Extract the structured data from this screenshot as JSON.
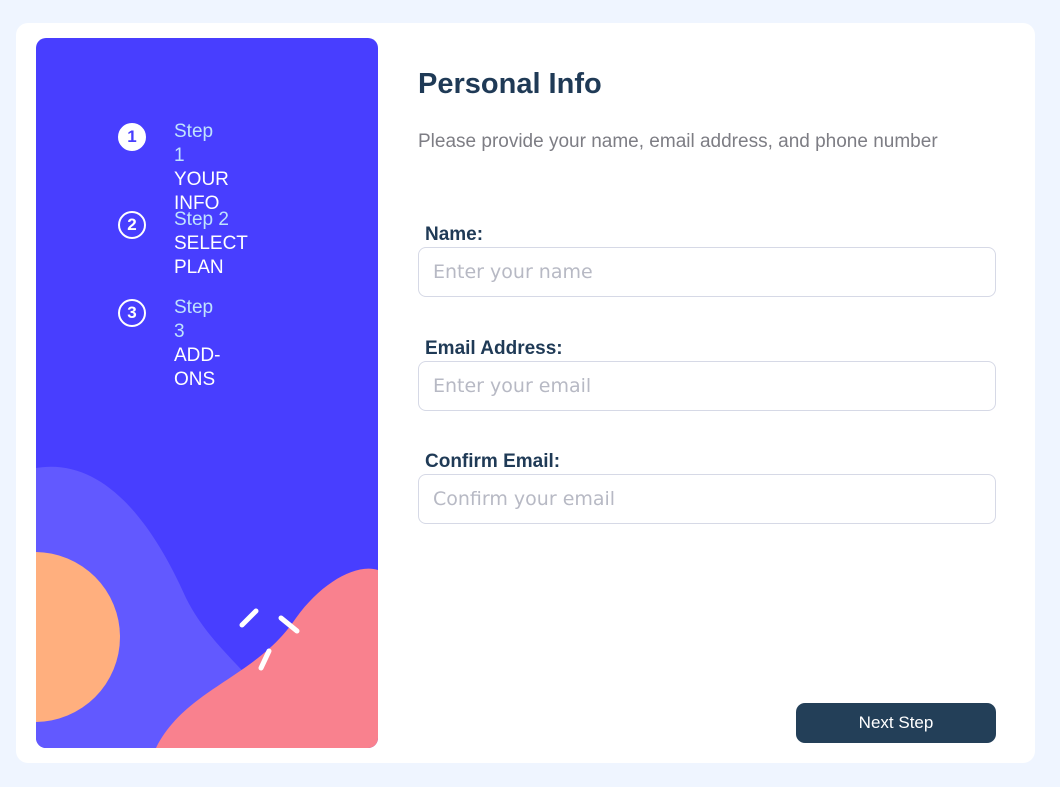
{
  "sidebar": {
    "steps": [
      {
        "number": "1",
        "step_label": "Step 1",
        "title": "YOUR INFO",
        "active": true
      },
      {
        "number": "2",
        "step_label": "Step 2",
        "title": "SELECT PLAN",
        "active": false
      },
      {
        "number": "3",
        "step_label": "Step 3",
        "title": "ADD-ONS",
        "active": false
      }
    ]
  },
  "main": {
    "title": "Personal Info",
    "subtitle": "Please provide your name, email address, and phone number",
    "fields": [
      {
        "label": "Name:",
        "placeholder": "Enter your name",
        "value": ""
      },
      {
        "label": "Email Address:",
        "placeholder": "Enter your email",
        "value": ""
      },
      {
        "label": "Confirm Email:",
        "placeholder": "Confirm your email",
        "value": ""
      }
    ],
    "next_button": "Next Step"
  },
  "colors": {
    "sidebar_bg": "#483eff",
    "primary_text": "#1f3a56",
    "button_bg": "#233f58",
    "shape_purple": "#6259ff",
    "shape_orange": "#ffaf7e",
    "shape_pink": "#f9818e"
  }
}
